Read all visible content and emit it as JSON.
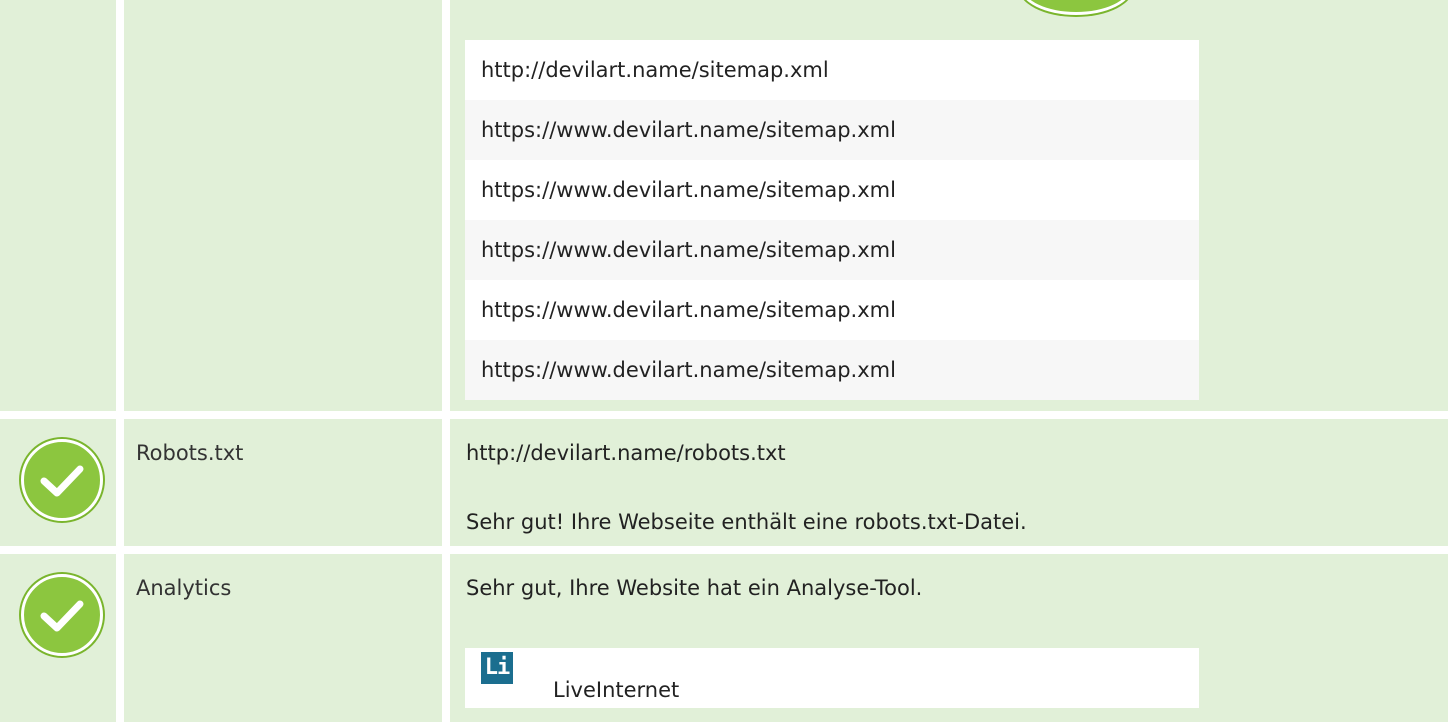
{
  "sitemap": {
    "urls": [
      "http://devilart.name/sitemap.xml",
      "https://www.devilart.name/sitemap.xml",
      "https://www.devilart.name/sitemap.xml",
      "https://www.devilart.name/sitemap.xml",
      "https://www.devilart.name/sitemap.xml",
      "https://www.devilart.name/sitemap.xml"
    ]
  },
  "robots": {
    "label": "Robots.txt",
    "url": "http://devilart.name/robots.txt",
    "message": "Sehr gut! Ihre Webseite enthält eine robots.txt-Datei.",
    "status_icon": "check-icon"
  },
  "analytics": {
    "label": "Analytics",
    "message": "Sehr gut, Ihre Website hat ein Analyse-Tool.",
    "tool_logo": "Li",
    "tool_name": "LiveInternet",
    "status_icon": "check-icon"
  },
  "colors": {
    "row_bg": "#e1f0d8",
    "check_green": "#8cc63f",
    "logo_blue": "#1b6e8f"
  }
}
